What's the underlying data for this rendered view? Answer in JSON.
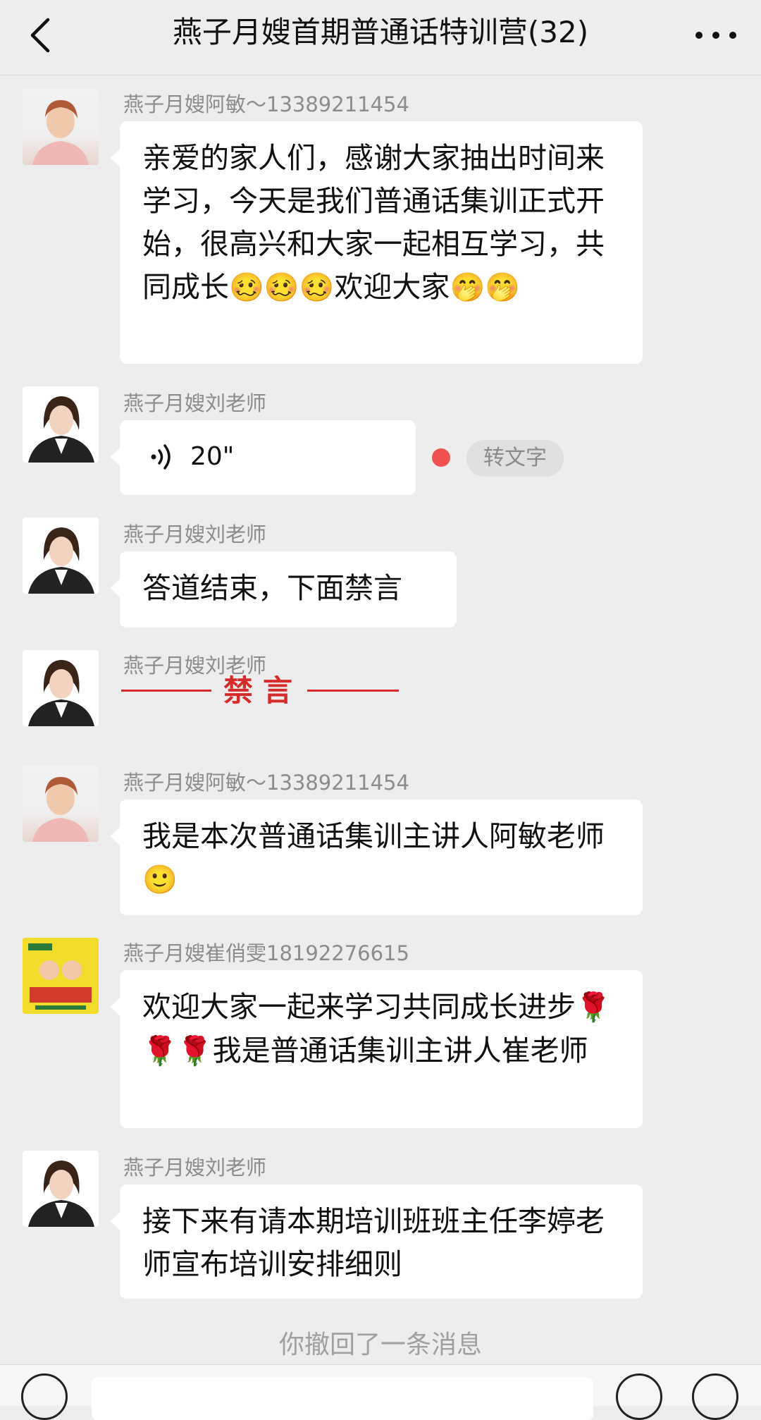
{
  "header": {
    "title": "燕子月嫂首期普通话特训营(32)",
    "back_icon": "chevron-left-icon",
    "more_icon": "more-dots-icon"
  },
  "messages": [
    {
      "sender": "燕子月嫂阿敏～13389211454",
      "avatar": "avatar-amin",
      "type": "text",
      "text": "亲爱的家人们，感谢大家抽出时间来学习，今天是我们普通话集训正式开始，很高兴和大家一起相互学习，共同成长",
      "emoji_666": "🥴",
      "text_after_666": "欢迎大家",
      "emoji_end": "🤭"
    },
    {
      "sender": "燕子月嫂刘老师",
      "avatar": "avatar-liu",
      "type": "voice",
      "duration": "20\"",
      "transcribe_label": "转文字"
    },
    {
      "sender": "燕子月嫂刘老师",
      "avatar": "avatar-liu",
      "type": "text",
      "text": "答道结束，下面禁言"
    },
    {
      "sender": "燕子月嫂刘老师",
      "avatar": "avatar-liu",
      "type": "sticker",
      "text": "禁言"
    },
    {
      "sender": "燕子月嫂阿敏～13389211454",
      "avatar": "avatar-amin",
      "type": "text",
      "text": "我是本次普通话集训主讲人阿敏老师",
      "emoji_end": "🙂"
    },
    {
      "sender": "燕子月嫂崔俏雯18192276615",
      "avatar": "avatar-cui",
      "type": "text",
      "text_before": "欢迎大家一起来学习共同成长进步",
      "emoji_mid": "🌹",
      "text_after": "我是普通话集训主讲人崔老师"
    },
    {
      "sender": "燕子月嫂刘老师",
      "avatar": "avatar-liu",
      "type": "text",
      "text": "接下来有请本期培训班班主任李婷老师宣布培训安排细则"
    }
  ],
  "system_note": "你撤回了一条消息",
  "colors": {
    "background": "#ededed",
    "bubble": "#ffffff",
    "ban_red": "#d62b2b",
    "unread_dot": "#f05050"
  }
}
